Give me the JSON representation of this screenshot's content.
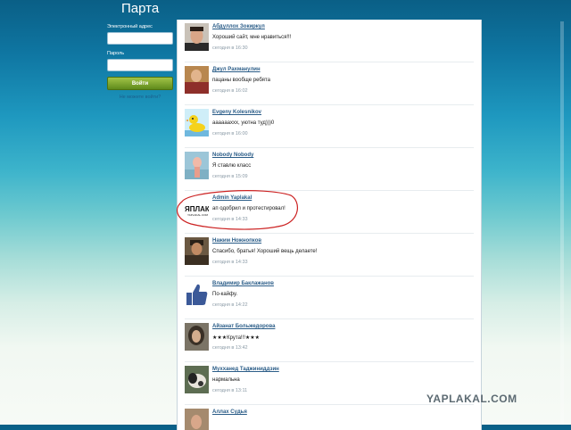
{
  "header": {
    "title": "Парта"
  },
  "login": {
    "email_label": "Электронный адрес",
    "password_label": "Пароль",
    "submit_label": "Войти",
    "forgot_label": "Не можете войти?"
  },
  "feed": [
    {
      "name": "Абдуллох Зокиркул",
      "message": "Хороший сайт, мне нравиться!!!",
      "time": "сегодня в 16:30",
      "avatar": "man-portrait-photo"
    },
    {
      "name": "Джул Рахманулин",
      "message": "пацаны вообще ребята",
      "time": "сегодня в 16:02",
      "avatar": "person-photo"
    },
    {
      "name": "Evgeny Kolesnikov",
      "message": "ааааааххх, уютна туд)))0",
      "time": "сегодня в 16:00",
      "avatar": "yellow-duck-picture"
    },
    {
      "name": "Nobody Nobody",
      "message": "Я ставлю класс",
      "time": "сегодня в 15:09",
      "avatar": "figure-photo"
    },
    {
      "name": "Admin Yaplakal",
      "message": "ап одобрил и протестировал!",
      "time": "сегодня в 14:33",
      "avatar": "yaplakal-logo",
      "logo_text": "ЯПЛАКАЛ",
      "logo_subtext": "YAPLAKAL.COM"
    },
    {
      "name": "Нажим Ножнопков",
      "message": "Спасибо, братья! Хороший вещь делаете!",
      "time": "сегодня в 14:33",
      "avatar": "old-man-photo"
    },
    {
      "name": "Владимир Баклажанов",
      "message": "По-кайфу.",
      "time": "сегодня в 14:22",
      "avatar": "thumbs-up-picture"
    },
    {
      "name": "Айзанат Больжедорова",
      "message": "★★★Крута!!!★★★",
      "time": "сегодня в 13:42",
      "avatar": "woman-photo"
    },
    {
      "name": "Мухханед Таджиниддзин",
      "message": "нармальна",
      "time": "сегодня в 13:11",
      "avatar": "animal-photo"
    },
    {
      "name": "Аллах Судья",
      "message": "",
      "time": "",
      "avatar": "person-photo"
    }
  ],
  "watermark": "YAPLAKAL.COM",
  "colors": {
    "brand_blue": "#0f76a2",
    "link_blue": "#2b5d88",
    "button_green": "#7ba52d",
    "annotation_red": "#cc2222"
  }
}
